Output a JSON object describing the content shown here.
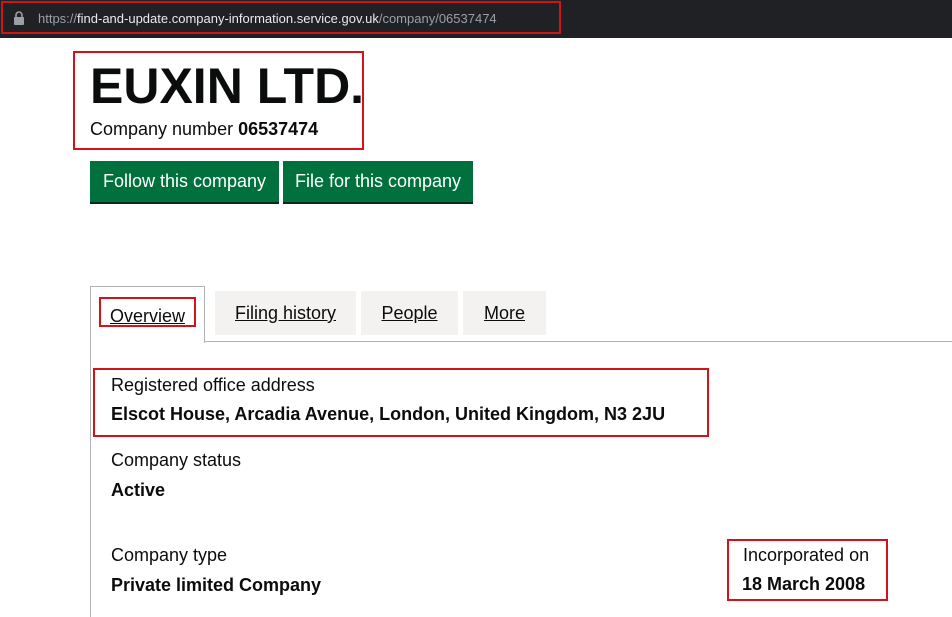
{
  "browser": {
    "url_scheme": "https://",
    "url_host": "find-and-update.company-information.service.gov.uk",
    "url_path": "/company/06537474",
    "lock_icon": "lock-icon"
  },
  "company": {
    "name": "EUXIN LTD.",
    "number_label": "Company number",
    "number": "06537474"
  },
  "actions": {
    "follow_label": "Follow this company",
    "file_label": "File for this company"
  },
  "tabs": [
    {
      "label": "Overview",
      "selected": true
    },
    {
      "label": "Filing history",
      "selected": false
    },
    {
      "label": "People",
      "selected": false
    },
    {
      "label": "More",
      "selected": false
    }
  ],
  "overview": {
    "address_label": "Registered office address",
    "address_value": "Elscot House, Arcadia Avenue, London, United Kingdom, N3 2JU",
    "status_label": "Company status",
    "status_value": "Active",
    "type_label": "Company type",
    "type_value": "Private limited Company",
    "incorporated_label": "Incorporated on",
    "incorporated_value": "18 March 2008"
  },
  "colors": {
    "button_green": "#00703c",
    "highlight_red": "#d4121a",
    "tab_grey": "#f3f2f1",
    "urlbar_dark": "#202124"
  }
}
